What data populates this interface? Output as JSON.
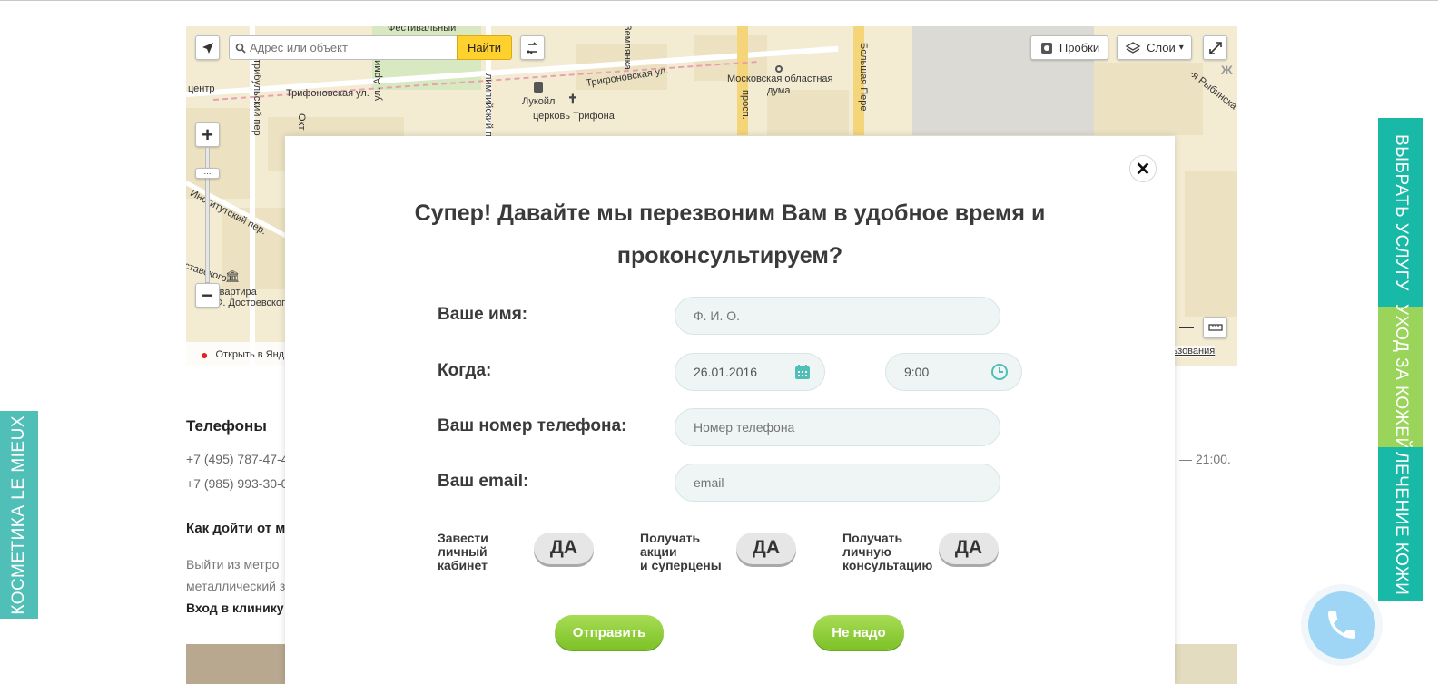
{
  "map": {
    "search_placeholder": "Адрес или объект",
    "find_label": "Найти",
    "traffic_label": "Пробки",
    "layers_label": "Слои",
    "open_in_yandex": "Открыть в Янд",
    "terms_fragment": "льзования",
    "streets": {
      "trifonovskaya_left": "Трифоновская ул.",
      "trifonovskaya_right": "Трифоновская ул.",
      "institutsky": "Институтский пер.",
      "lukoil": "Лукойл",
      "church": "церковь Трифона",
      "duma_line1": "Московская областная",
      "duma_line2": "дума",
      "festival": "Фестивальный",
      "zemlyanka": "Землянка",
      "prosp": "просп.",
      "bolshaya_pere": "Большая Пере",
      "olimp_pr": "лимпийский пр",
      "armii": "ул. Армии",
      "oktyabr": "Окт",
      "center": "центр",
      "kvartira_1": "й-квартира",
      "kvartira_2": "Ф. Достоевского",
      "stakhovsky": "ставского",
      "stroganov": "трибульский пер",
      "rybinskaya": "-я Рыбинска",
      "zh": "Ж"
    }
  },
  "contacts": {
    "title": "Телефоны",
    "phones": [
      "+7 (495) 787-47-4",
      "+7 (985) 993-30-0"
    ],
    "how_title": "Как дойти от м",
    "how_lines": [
      "Выйти из метро",
      "металлический з"
    ],
    "entry": "Вход в клинику",
    "hours_fragment": "— 21:00."
  },
  "side_tabs": {
    "left": "КОСМЕТИКА LE MIEUX",
    "right_1": "ВЫБРАТЬ УСЛУГУ",
    "right_2": "УХОД ЗА КОЖЕЙ",
    "right_3": "ЛЕЧЕНИЕ КОЖИ"
  },
  "modal": {
    "title": "Супер! Давайте мы перезвоним Вам в удобное время и проконсультируем?",
    "name_label": "Ваше имя:",
    "name_placeholder": "Ф. И. О.",
    "when_label": "Когда:",
    "date_value": "26.01.2016",
    "time_value": "9:00",
    "phone_label": "Ваш номер телефона:",
    "phone_placeholder": "Номер телефона",
    "email_label": "Ваш email:",
    "email_placeholder": "email",
    "options": [
      {
        "line1": "Завести",
        "line2": "личный",
        "line3": "кабинет",
        "button": "ДА"
      },
      {
        "line1": "Получать",
        "line2": "акции",
        "line3": "и суперцены",
        "button": "ДА"
      },
      {
        "line1": "Получать",
        "line2": "личную",
        "line3": "консультацию",
        "button": "ДА"
      }
    ],
    "submit_label": "Отправить",
    "decline_label": "Не надо"
  },
  "colors": {
    "teal": "#19b9a8",
    "green": "#9ad45b",
    "button_green": "#7dc227",
    "yandex_yellow": "#ffd12e"
  }
}
